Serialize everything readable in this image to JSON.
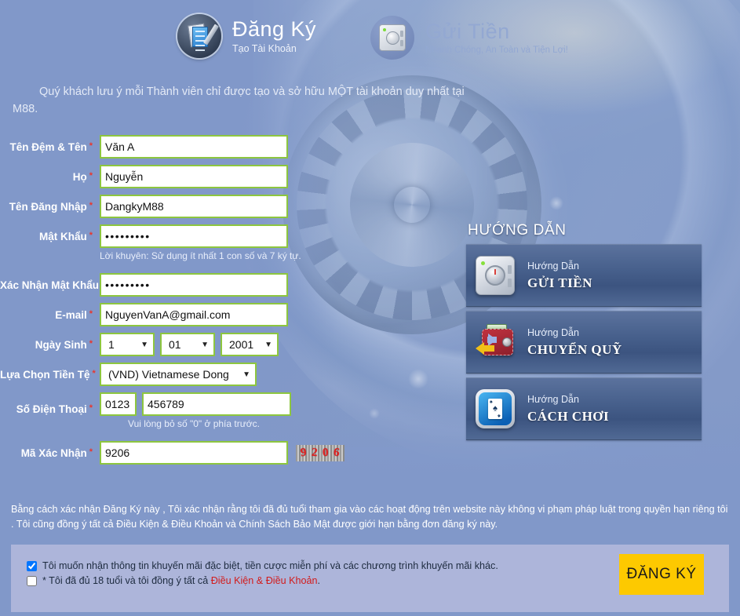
{
  "header": {
    "tabs": [
      {
        "id": "register",
        "icon": "document-pen-icon",
        "title": "Đăng Ký",
        "subtitle": "Tạo Tài Khoản",
        "active": true
      },
      {
        "id": "deposit",
        "icon": "safe-icon",
        "title": "Gửi Tiền",
        "subtitle": "Nhanh Chóng, An Toàn và Tiện Lợi!",
        "active": false
      }
    ]
  },
  "notice": "Quý khách lưu ý mỗi Thành viên chỉ được tạo và sở hữu MỘT tài khoản duy nhất tại M88.",
  "form": {
    "first_name": {
      "label": "Tên Đệm & Tên",
      "required": "*",
      "value": "Văn A"
    },
    "last_name": {
      "label": "Họ",
      "required": "*",
      "value": "Nguyễn"
    },
    "username": {
      "label": "Tên Đăng Nhập",
      "required": "*",
      "value": "DangkyM88"
    },
    "password": {
      "label": "Mật Khẩu",
      "required": "*",
      "value": "•••••••••",
      "hint": "Lời khuyên: Sử dụng ít nhất 1 con số và 7 ký tự."
    },
    "confirm_password": {
      "label": "Xác Nhận Mật Khẩu",
      "required": "*",
      "value": "•••••••••"
    },
    "email": {
      "label": "E-mail",
      "required": "*",
      "value": "NguyenVanA@gmail.com"
    },
    "dob": {
      "label": "Ngày Sinh",
      "required": "*",
      "day": "1",
      "month": "01",
      "year": "2001",
      "caret": "▼"
    },
    "currency": {
      "label": "Lựa Chọn Tiền Tệ",
      "required": "*",
      "value": "(VND) Vietnamese Dong",
      "caret": "▼"
    },
    "phone": {
      "label": "Số Điện Thoại",
      "required": "*",
      "country_code": "0123",
      "number": "456789",
      "hint": "Vui lòng bỏ số \"0\" ở phía trước."
    },
    "captcha": {
      "label": "Mã Xác Nhận",
      "required": "*",
      "value": "9206",
      "image_digits": [
        "9",
        "2",
        "0",
        "6"
      ]
    }
  },
  "guide": {
    "title": "HƯỚNG DẪN",
    "cards": [
      {
        "icon": "safe-icon",
        "eyebrow": "Hướng Dẫn",
        "title": "GỬI TIỀN"
      },
      {
        "icon": "wallet-transfer-icon",
        "eyebrow": "Hướng Dẫn",
        "title": "CHUYỂN QUỸ"
      },
      {
        "icon": "playing-cards-icon",
        "eyebrow": "Hướng Dẫn",
        "title": "CÁCH CHƠI"
      }
    ]
  },
  "terms": {
    "paragraph": "Bằng cách xác nhận Đăng Ký này , Tôi xác nhận rằng tôi đã đủ tuổi tham gia vào các hoạt động trên website này không vi phạm pháp luật trong quyền hạn riêng tôi . Tôi cũng đồng ý tất cả Điều Kiện & Điều Khoản và Chính Sách Bảo Mật được giới hạn bằng đơn đăng ký này."
  },
  "agreements": {
    "promo": {
      "checked": true,
      "label": "Tôi muốn nhận thông tin khuyến mãi đặc biệt, tiền cược miễn phí và các chương trình khuyến mãi khác."
    },
    "age": {
      "checked": false,
      "prefix": "* Tôi đã đủ 18 tuổi và tôi đồng ý tất cả ",
      "link": "Điều Kiện & Điều Khoản",
      "suffix": "."
    }
  },
  "submit_label": "ĐĂNG KÝ",
  "colors": {
    "page_background": "#8198c9",
    "input_border": "#8dc63f",
    "required_star": "#e8372e",
    "submit_background": "#fdc900",
    "link_red": "#d21b1b",
    "agree_panel": "#adb5da",
    "captcha_text": "#e02020"
  }
}
